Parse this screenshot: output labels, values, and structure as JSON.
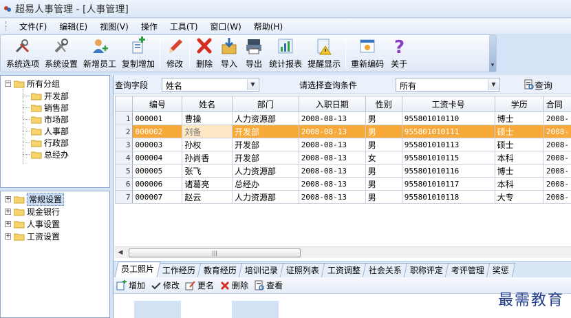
{
  "window": {
    "title": "超易人事管理 - [人事管理]"
  },
  "menu": [
    "文件(F)",
    "编辑(E)",
    "视图(V)",
    "操作",
    "工具(T)",
    "窗口(W)",
    "帮助(H)"
  ],
  "toolbar": {
    "buttons": [
      {
        "label": "系统选项",
        "icon": "tools-icon"
      },
      {
        "label": "系统设置",
        "icon": "wrench-icon"
      },
      {
        "label": "新增员工",
        "icon": "add-user-icon"
      },
      {
        "label": "复制增加",
        "icon": "copy-add-icon"
      },
      {
        "label": "修改",
        "icon": "pencil-icon"
      },
      {
        "label": "删除",
        "icon": "delete-icon"
      },
      {
        "label": "导入",
        "icon": "import-icon"
      },
      {
        "label": "导出",
        "icon": "export-icon"
      },
      {
        "label": "统计报表",
        "icon": "chart-icon"
      },
      {
        "label": "提醒显示",
        "icon": "reminder-icon"
      },
      {
        "label": "重新编码",
        "icon": "recode-icon"
      },
      {
        "label": "关于",
        "icon": "help-icon"
      }
    ]
  },
  "tree_groups": {
    "root": "所有分组",
    "children": [
      "开发部",
      "销售部",
      "市场部",
      "人事部",
      "行政部",
      "总经办"
    ]
  },
  "tree_settings": [
    "常规设置",
    "现金银行",
    "人事设置",
    "工资设置"
  ],
  "query": {
    "field_label": "查询字段",
    "field_value": "姓名",
    "condition_label": "请选择查询条件",
    "condition_value": "所有",
    "button": "查询"
  },
  "grid": {
    "columns": [
      "编号",
      "姓名",
      "部门",
      "入职日期",
      "性别",
      "工资卡号",
      "学历",
      "合同"
    ],
    "rows": [
      {
        "n": "1",
        "cells": [
          "000001",
          "曹操",
          "人力资源部",
          "2008-08-13",
          "男",
          "955801010110",
          "博士",
          "2008-"
        ]
      },
      {
        "n": "2",
        "cells": [
          "000002",
          "刘备",
          "开发部",
          "2008-08-13",
          "男",
          "955801010111",
          "硕士",
          "2008-"
        ]
      },
      {
        "n": "3",
        "cells": [
          "000003",
          "孙权",
          "开发部",
          "2008-08-13",
          "男",
          "955801010113",
          "硕士",
          "2008-"
        ]
      },
      {
        "n": "4",
        "cells": [
          "000004",
          "孙尚香",
          "开发部",
          "2008-08-13",
          "女",
          "955801010115",
          "本科",
          "2008-"
        ]
      },
      {
        "n": "5",
        "cells": [
          "000005",
          "张飞",
          "人力资源部",
          "2008-08-13",
          "男",
          "955801010116",
          "博士",
          "2008-"
        ]
      },
      {
        "n": "6",
        "cells": [
          "000006",
          "诸葛亮",
          "总经办",
          "2008-08-13",
          "男",
          "955801010117",
          "本科",
          "2008-"
        ]
      },
      {
        "n": "7",
        "cells": [
          "000007",
          "赵云",
          "人力资源部",
          "2008-08-13",
          "男",
          "955801010118",
          "大专",
          "2008-"
        ]
      }
    ],
    "selected_row": 1
  },
  "tabs": [
    "员工照片",
    "工作经历",
    "教育经历",
    "培训记录",
    "证照列表",
    "工资调整",
    "社会关系",
    "职称评定",
    "考评管理",
    "奖惩"
  ],
  "subtoolbar": [
    {
      "label": "增加",
      "icon": "add-icon"
    },
    {
      "label": "修改",
      "icon": "edit-icon"
    },
    {
      "label": "更名",
      "icon": "rename-icon"
    },
    {
      "label": "删除",
      "icon": "delete-icon"
    },
    {
      "label": "查看",
      "icon": "view-icon"
    }
  ],
  "watermark": "最需教育"
}
